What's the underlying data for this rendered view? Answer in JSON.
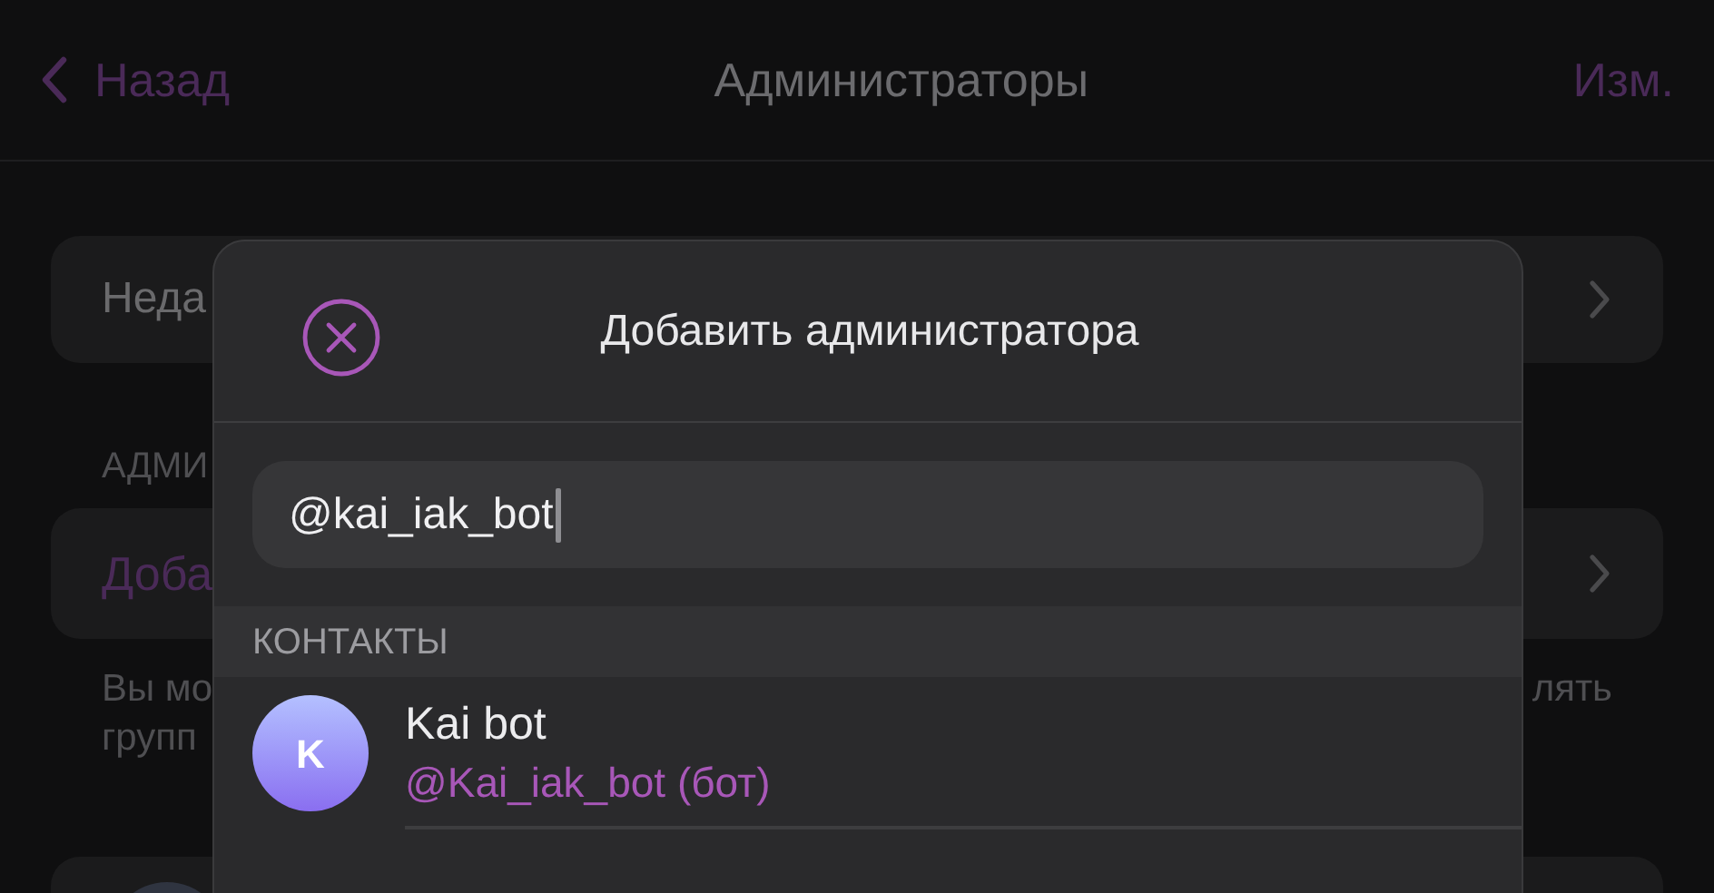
{
  "header": {
    "back": "Назад",
    "title": "Администраторы",
    "edit": "Изм."
  },
  "background": {
    "row_1": "Неда",
    "section": "АДМИ",
    "row_2": "Доба",
    "note_left": [
      "Вы мо",
      "групп"
    ],
    "note_right": "лять"
  },
  "dialog": {
    "title": "Добавить администратора",
    "search": {
      "value": "@kai_iak_bot"
    },
    "section": "КОНТАКТЫ",
    "contacts": [
      {
        "initial": "K",
        "name": "Kai bot",
        "username": "@Kai_iak_bot (бот)"
      }
    ]
  }
}
